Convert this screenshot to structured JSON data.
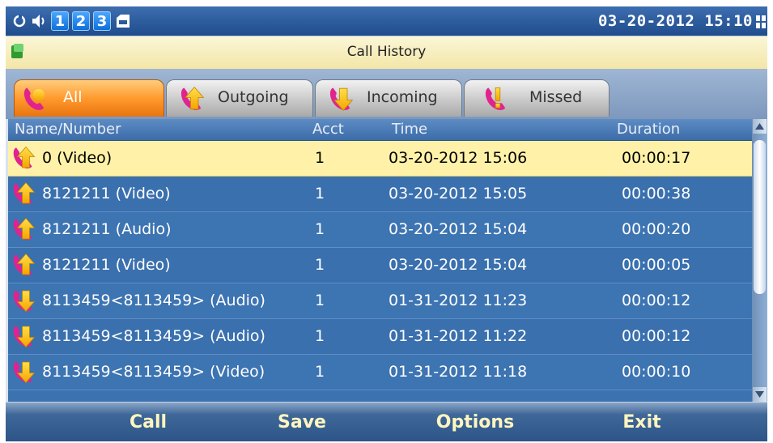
{
  "status_bar": {
    "indicators": [
      "refresh-icon",
      "speaker-icon",
      "1",
      "2",
      "3",
      "cassette-icon"
    ],
    "clock": "03-20-2012 15:10"
  },
  "title_bar": {
    "title": "Call History"
  },
  "tabs": [
    {
      "label": "All",
      "active": true
    },
    {
      "label": "Outgoing",
      "active": false
    },
    {
      "label": "Incoming",
      "active": false
    },
    {
      "label": "Missed",
      "active": false
    }
  ],
  "list": {
    "columns": [
      "Name/Number",
      "Acct",
      "Time",
      "Duration"
    ],
    "rows": [
      {
        "type": "outgoing",
        "name": "0 (Video)",
        "acct": "1",
        "time": "03-20-2012 15:06",
        "duration": "00:00:17",
        "selected": true
      },
      {
        "type": "outgoing",
        "name": "8121211 (Video)",
        "acct": "1",
        "time": "03-20-2012 15:05",
        "duration": "00:00:38"
      },
      {
        "type": "outgoing",
        "name": "8121211 (Audio)",
        "acct": "1",
        "time": "03-20-2012 15:04",
        "duration": "00:00:20"
      },
      {
        "type": "outgoing",
        "name": "8121211 (Video)",
        "acct": "1",
        "time": "03-20-2012 15:04",
        "duration": "00:00:05"
      },
      {
        "type": "incoming",
        "name": "8113459<8113459> (Audio)",
        "acct": "1",
        "time": "01-31-2012 11:23",
        "duration": "00:00:12"
      },
      {
        "type": "incoming",
        "name": "8113459<8113459> (Audio)",
        "acct": "1",
        "time": "01-31-2012 11:22",
        "duration": "00:00:12"
      },
      {
        "type": "incoming",
        "name": "8113459<8113459> (Video)",
        "acct": "1",
        "time": "01-31-2012 11:18",
        "duration": "00:00:10"
      }
    ]
  },
  "softkeys": {
    "call": "Call",
    "save": "Save",
    "options": "Options",
    "exit": "Exit"
  },
  "colors": {
    "accent": "#ff9a2e",
    "selected_row": "#fff2a8",
    "list_bg": "#3b72b0",
    "softkey_text": "#fff5c0"
  }
}
